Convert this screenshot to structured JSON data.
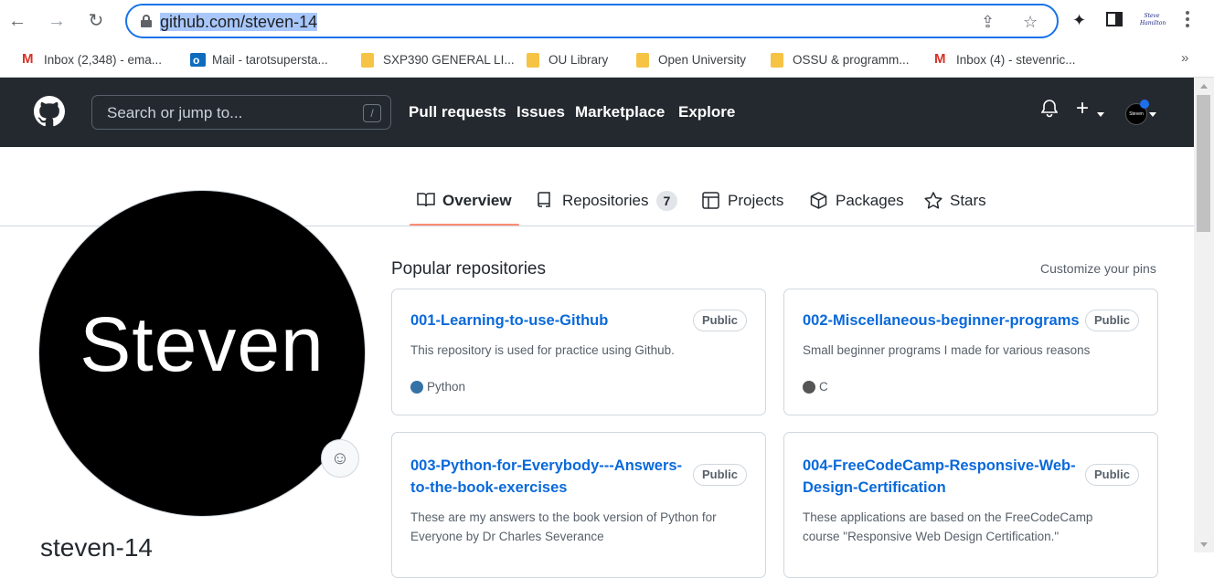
{
  "browser": {
    "url": "github.com/steven-14",
    "profile_label": "Steve Hamilton",
    "bookmarks": [
      {
        "label": "Inbox (2,348) - ema...",
        "icon": "gmail-icon"
      },
      {
        "label": "Mail - tarotsupersta...",
        "icon": "outlook-icon"
      },
      {
        "label": "SXP390 GENERAL LI...",
        "icon": "folder-icon"
      },
      {
        "label": "OU Library",
        "icon": "folder-icon"
      },
      {
        "label": "Open University",
        "icon": "folder-icon"
      },
      {
        "label": "OSSU & programm...",
        "icon": "folder-icon"
      },
      {
        "label": "Inbox (4) - stevenric...",
        "icon": "gmail-icon"
      }
    ],
    "overflow": "»"
  },
  "header": {
    "search_placeholder": "Search or jump to...",
    "search_shortcut": "/",
    "nav": [
      "Pull requests",
      "Issues",
      "Marketplace",
      "Explore"
    ],
    "avatar_text": "Steven"
  },
  "tabs": [
    {
      "label": "Overview",
      "active": true
    },
    {
      "label": "Repositories",
      "count": "7"
    },
    {
      "label": "Projects"
    },
    {
      "label": "Packages"
    },
    {
      "label": "Stars"
    }
  ],
  "profile": {
    "avatar_text": "Steven",
    "username": "steven-14"
  },
  "popular": {
    "title": "Popular repositories",
    "customize": "Customize your pins",
    "repos": [
      {
        "name": "001-Learning-to-use-Github",
        "visibility": "Public",
        "description": "This repository is used for practice using Github.",
        "language": "Python",
        "lang_color": "#3572A5"
      },
      {
        "name": "002-Miscellaneous-beginner-programs",
        "visibility": "Public",
        "description": "Small beginner programs I made for various reasons",
        "language": "C",
        "lang_color": "#555555"
      },
      {
        "name_line1": "003-Python-for-Everybody---Answers-",
        "name_line2": "to-the-book-exercises",
        "visibility": "Public",
        "desc_line1": "These are my answers to the book version of Python for",
        "desc_line2": "Everyone by Dr Charles Severance"
      },
      {
        "name_line1": "004-FreeCodeCamp-Responsive-Web-",
        "name_line2": "Design-Certification",
        "visibility": "Public",
        "desc_line1": "These applications are based on the FreeCodeCamp",
        "desc_line2": "course \"Responsive Web Design Certification.\""
      }
    ]
  }
}
